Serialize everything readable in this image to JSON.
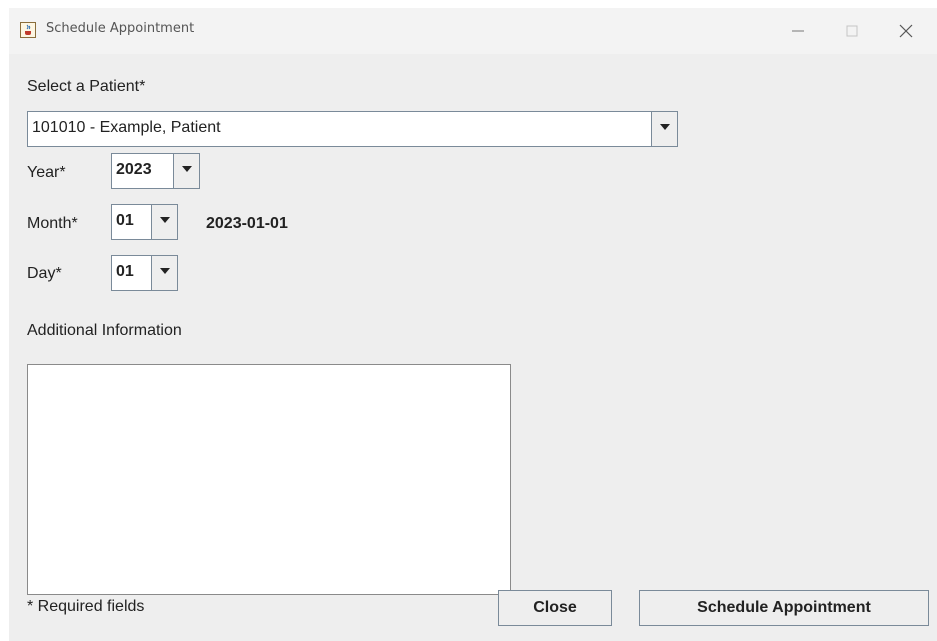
{
  "window": {
    "title": "Schedule Appointment",
    "icons": {
      "app": "java-cup-icon",
      "minimize": "minimize-icon",
      "maximize": "maximize-icon",
      "close": "close-icon"
    }
  },
  "form": {
    "patient_label": "Select a Patient*",
    "patient_value": "101010 - Example, Patient",
    "year_label": "Year*",
    "year_value": "2023",
    "month_label": "Month*",
    "month_value": "01",
    "date_display": "2023-01-01",
    "day_label": "Day*",
    "day_value": "01",
    "additional_label": "Additional Information",
    "additional_value": ""
  },
  "footer": {
    "required_note": "* Required fields",
    "close_label": "Close",
    "schedule_label": "Schedule Appointment"
  },
  "colors": {
    "background": "#eeeeee",
    "titlebar": "#f3f3f3",
    "field": "#ffffff",
    "border": "#7a8a99"
  }
}
